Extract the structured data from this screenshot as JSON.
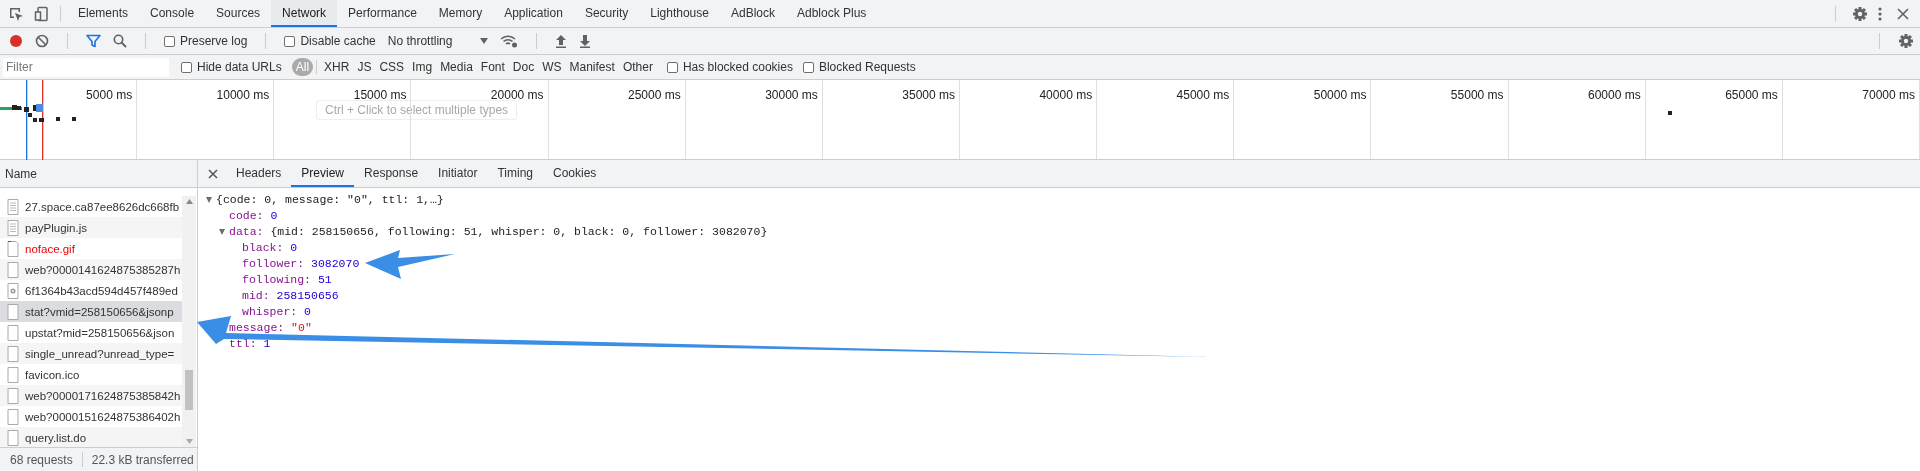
{
  "main_tabs": [
    {
      "label": "Elements",
      "selected": false
    },
    {
      "label": "Console",
      "selected": false
    },
    {
      "label": "Sources",
      "selected": false
    },
    {
      "label": "Network",
      "selected": true
    },
    {
      "label": "Performance",
      "selected": false
    },
    {
      "label": "Memory",
      "selected": false
    },
    {
      "label": "Application",
      "selected": false
    },
    {
      "label": "Security",
      "selected": false
    },
    {
      "label": "Lighthouse",
      "selected": false
    },
    {
      "label": "AdBlock",
      "selected": false
    },
    {
      "label": "Adblock Plus",
      "selected": false
    }
  ],
  "toolbar": {
    "recording": true,
    "filter_active": true,
    "preserve_log": {
      "label": "Preserve log",
      "checked": false
    },
    "disable_cache": {
      "label": "Disable cache",
      "checked": false
    },
    "throttling": "No throttling"
  },
  "filter_bar": {
    "placeholder": "Filter",
    "hide_data_urls": {
      "label": "Hide data URLs",
      "checked": false
    },
    "types": [
      {
        "label": "All",
        "selected": true
      },
      {
        "label": "XHR",
        "selected": false
      },
      {
        "label": "JS",
        "selected": false
      },
      {
        "label": "CSS",
        "selected": false
      },
      {
        "label": "Img",
        "selected": false
      },
      {
        "label": "Media",
        "selected": false
      },
      {
        "label": "Font",
        "selected": false
      },
      {
        "label": "Doc",
        "selected": false
      },
      {
        "label": "WS",
        "selected": false
      },
      {
        "label": "Manifest",
        "selected": false
      },
      {
        "label": "Other",
        "selected": false
      }
    ],
    "blocked_cookies": {
      "label": "Has blocked cookies",
      "checked": false
    },
    "blocked_requests": {
      "label": "Blocked Requests",
      "checked": false
    }
  },
  "overview": {
    "ticks": [
      "5000 ms",
      "10000 ms",
      "15000 ms",
      "20000 ms",
      "25000 ms",
      "30000 ms",
      "35000 ms",
      "40000 ms",
      "45000 ms",
      "50000 ms",
      "55000 ms",
      "60000 ms",
      "65000 ms",
      "70000 ms"
    ],
    "tooltip": "Ctrl + Click to select multiple types"
  },
  "requests": {
    "header": "Name",
    "rows": [
      {
        "name": "27.space.ca87ee8626dc668fb",
        "kind": "document",
        "error": false,
        "selected": false
      },
      {
        "name": "payPlugin.js",
        "kind": "document",
        "error": false,
        "selected": false
      },
      {
        "name": "noface.gif",
        "kind": "image",
        "error": true,
        "selected": false
      },
      {
        "name": "web?0000141624875385287h",
        "kind": "plain",
        "error": false,
        "selected": false
      },
      {
        "name": "6f1364b43acd594d457f489ed",
        "kind": "font",
        "error": false,
        "selected": false
      },
      {
        "name": "stat?vmid=258150656&jsonp",
        "kind": "plain",
        "error": false,
        "selected": true
      },
      {
        "name": "upstat?mid=258150656&json",
        "kind": "plain",
        "error": false,
        "selected": false
      },
      {
        "name": "single_unread?unread_type=",
        "kind": "plain",
        "error": false,
        "selected": false
      },
      {
        "name": "favicon.ico",
        "kind": "plain",
        "error": false,
        "selected": false
      },
      {
        "name": "web?0000171624875385842h",
        "kind": "plain",
        "error": false,
        "selected": false
      },
      {
        "name": "web?0000151624875386402h",
        "kind": "plain",
        "error": false,
        "selected": false
      },
      {
        "name": "query.list.do",
        "kind": "plain",
        "error": false,
        "selected": false
      }
    ]
  },
  "details": {
    "tabs": [
      {
        "label": "Headers",
        "selected": false
      },
      {
        "label": "Preview",
        "selected": true
      },
      {
        "label": "Response",
        "selected": false
      },
      {
        "label": "Initiator",
        "selected": false
      },
      {
        "label": "Timing",
        "selected": false
      },
      {
        "label": "Cookies",
        "selected": false
      }
    ],
    "preview": {
      "summary": "{code: 0, message: \"0\", ttl: 1,…}",
      "expanded": true,
      "children": [
        {
          "key": "code:",
          "value": "0",
          "kind": "number"
        },
        {
          "key": "data:",
          "summary": "{mid: 258150656, following: 51, whisper: 0, black: 0, follower: 3082070}",
          "expanded": true,
          "children": [
            {
              "key": "black:",
              "value": "0",
              "kind": "number"
            },
            {
              "key": "follower:",
              "value": "3082070",
              "kind": "number"
            },
            {
              "key": "following:",
              "value": "51",
              "kind": "number"
            },
            {
              "key": "mid:",
              "value": "258150656",
              "kind": "number"
            },
            {
              "key": "whisper:",
              "value": "0",
              "kind": "number"
            }
          ]
        },
        {
          "key": "message:",
          "value": "\"0\"",
          "kind": "string"
        },
        {
          "key": "ttl:",
          "value": "1",
          "kind": "number"
        }
      ]
    }
  },
  "status": {
    "requests": "68 requests",
    "transferred": "22.3 kB transferred"
  }
}
